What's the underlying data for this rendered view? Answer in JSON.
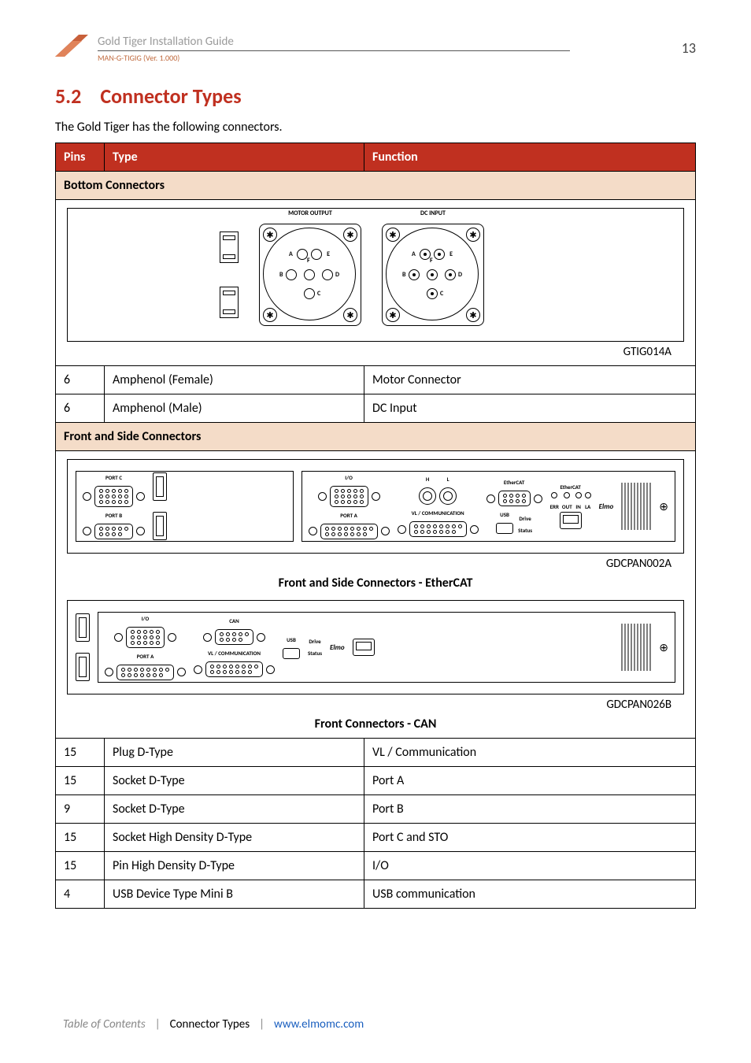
{
  "header": {
    "doc_title": "Gold Tiger Installation Guide",
    "doc_version": "MAN-G-TIGIG (Ver. 1.000)",
    "page_number": "13"
  },
  "section": {
    "number": "5.2",
    "title": "Connector Types"
  },
  "intro": "The Gold Tiger has the following connectors.",
  "table": {
    "headers": {
      "pins": "Pins",
      "type": "Type",
      "function": "Function"
    },
    "groups": [
      {
        "title": "Bottom Connectors",
        "diagram": {
          "motor_label": "MOTOR OUTPUT",
          "dc_label": "DC INPUT",
          "pin_labels": {
            "a": "A",
            "b": "B",
            "c": "C",
            "d": "D",
            "e": "E",
            "f": "F"
          },
          "id": "GTIG014A"
        },
        "rows": [
          {
            "pins": "6",
            "type": "Amphenol (Female)",
            "function": "Motor Connector"
          },
          {
            "pins": "6",
            "type": "Amphenol (Male)",
            "function": "DC Input"
          }
        ]
      },
      {
        "title": "Front and Side Connectors",
        "diagrams": [
          {
            "id": "GDCPAN002A",
            "caption": "Front and Side Connectors - EtherCAT",
            "labels": {
              "portc": "PORT C",
              "portb": "PORT B",
              "io": "I/O",
              "h": "H",
              "l": "L",
              "ethercat": "EtherCAT",
              "porta": "PORT A",
              "vlcomm": "VL / COMMUNICATION",
              "usb": "USB",
              "drive": "Drive",
              "status": "Status",
              "err": "ERR",
              "in": "IN",
              "out": "OUT",
              "la": "LA",
              "elmo": "Elmo"
            }
          },
          {
            "id": "GDCPAN026B",
            "caption": "Front Connectors - CAN",
            "labels": {
              "io": "I/O",
              "can": "CAN",
              "porta": "PORT A",
              "vlcomm": "VL / COMMUNICATION",
              "usb": "USB",
              "drive": "Drive",
              "status": "Status",
              "elmo": "Elmo"
            }
          }
        ],
        "rows": [
          {
            "pins": "15",
            "type": "Plug D-Type",
            "function": "VL / Communication"
          },
          {
            "pins": "15",
            "type": "Socket D-Type",
            "function": "Port A"
          },
          {
            "pins": "9",
            "type": "Socket D-Type",
            "function": "Port B"
          },
          {
            "pins": "15",
            "type": "Socket High Density D-Type",
            "function": "Port C and STO"
          },
          {
            "pins": "15",
            "type": "Pin High Density D-Type",
            "function": "I/O"
          },
          {
            "pins": "4",
            "type": "USB Device Type Mini B",
            "function": "USB communication"
          }
        ]
      }
    ]
  },
  "footer": {
    "toc": "Table of Contents",
    "breadcrumb": "Connector Types",
    "url": "www.elmomc.com"
  }
}
